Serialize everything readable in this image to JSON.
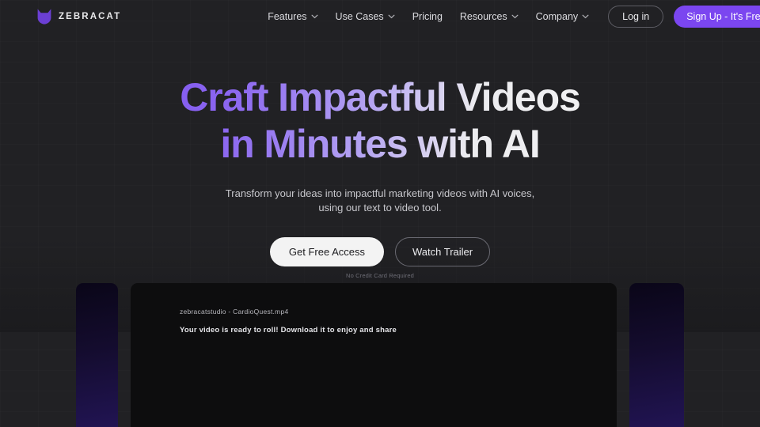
{
  "header": {
    "brand": {
      "logo_icon": "zebracat-cat-head-logo",
      "name": "ZEBRACAT",
      "accent_color": "#6b3fd4"
    },
    "nav": [
      {
        "label": "Features",
        "has_dropdown": true,
        "icon": "chevron-down-icon"
      },
      {
        "label": "Use Cases",
        "has_dropdown": true,
        "icon": "chevron-down-icon"
      },
      {
        "label": "Pricing",
        "has_dropdown": false,
        "icon": ""
      },
      {
        "label": "Resources",
        "has_dropdown": true,
        "icon": "chevron-down-icon"
      },
      {
        "label": "Company",
        "has_dropdown": true,
        "icon": "chevron-down-icon"
      }
    ],
    "login_label": "Log in",
    "signup_label": "Sign Up - It's Free",
    "signup_color": "#7b46f0"
  },
  "hero": {
    "headline_line1": "Craft Impactful Videos",
    "headline_line2": "in Minutes with AI",
    "headline_gradient_from": "#7141f2",
    "headline_gradient_to": "#fafafa",
    "subtitle_line1": "Transform your ideas into impactful marketing videos with AI voices,",
    "subtitle_line2": "using our text to video tool.",
    "primary_cta": "Get Free Access",
    "secondary_cta": "Watch Trailer",
    "disclaimer": "No Credit Card Required"
  },
  "preview": {
    "video_filename": "zebracatstudio - CardioQuest.mp4",
    "video_message": "Your video is ready to roll! Download it to enjoy and share",
    "side_panel_color": "#1a1040"
  },
  "page": {
    "background_color": "#212124"
  }
}
